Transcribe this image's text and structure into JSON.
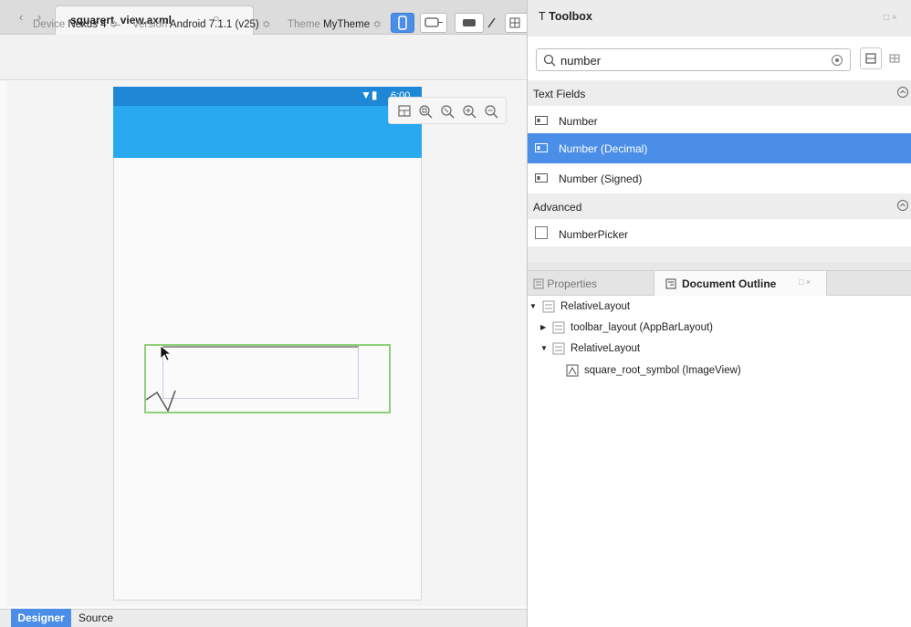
{
  "editor": {
    "file_tab": "squarert_view.axml",
    "device_label": "Device",
    "device_value": "Nexus 4",
    "version_label": "Version",
    "version_value": "Android 7.1.1 (v25)",
    "theme_label": "Theme",
    "theme_value": "MyTheme",
    "status_time": "6:00",
    "bottom_tabs": [
      "Designer",
      "Source"
    ]
  },
  "toolbox": {
    "title": "Toolbox",
    "search_value": "number",
    "sections": [
      {
        "title": "Text Fields",
        "items": [
          "Number",
          "Number (Decimal)",
          "Number (Signed)"
        ],
        "selected_index": 1
      },
      {
        "title": "Advanced",
        "items": [
          "NumberPicker"
        ]
      }
    ]
  },
  "panels": {
    "tabs": [
      "Properties",
      "Document Outline"
    ],
    "active": "Document Outline"
  },
  "outline": {
    "nodes": [
      {
        "label": "RelativeLayout",
        "depth": 0,
        "expanded": true
      },
      {
        "label": "toolbar_layout (AppBarLayout)",
        "depth": 1,
        "expanded": false
      },
      {
        "label": "RelativeLayout",
        "depth": 1,
        "expanded": true
      },
      {
        "label": "square_root_symbol (ImageView)",
        "depth": 2
      }
    ]
  },
  "colors": {
    "accent": "#4a8ee8",
    "statusbar": "#1e88d6",
    "appbar": "#29a9ef",
    "selection_outline": "#8ed07a"
  }
}
